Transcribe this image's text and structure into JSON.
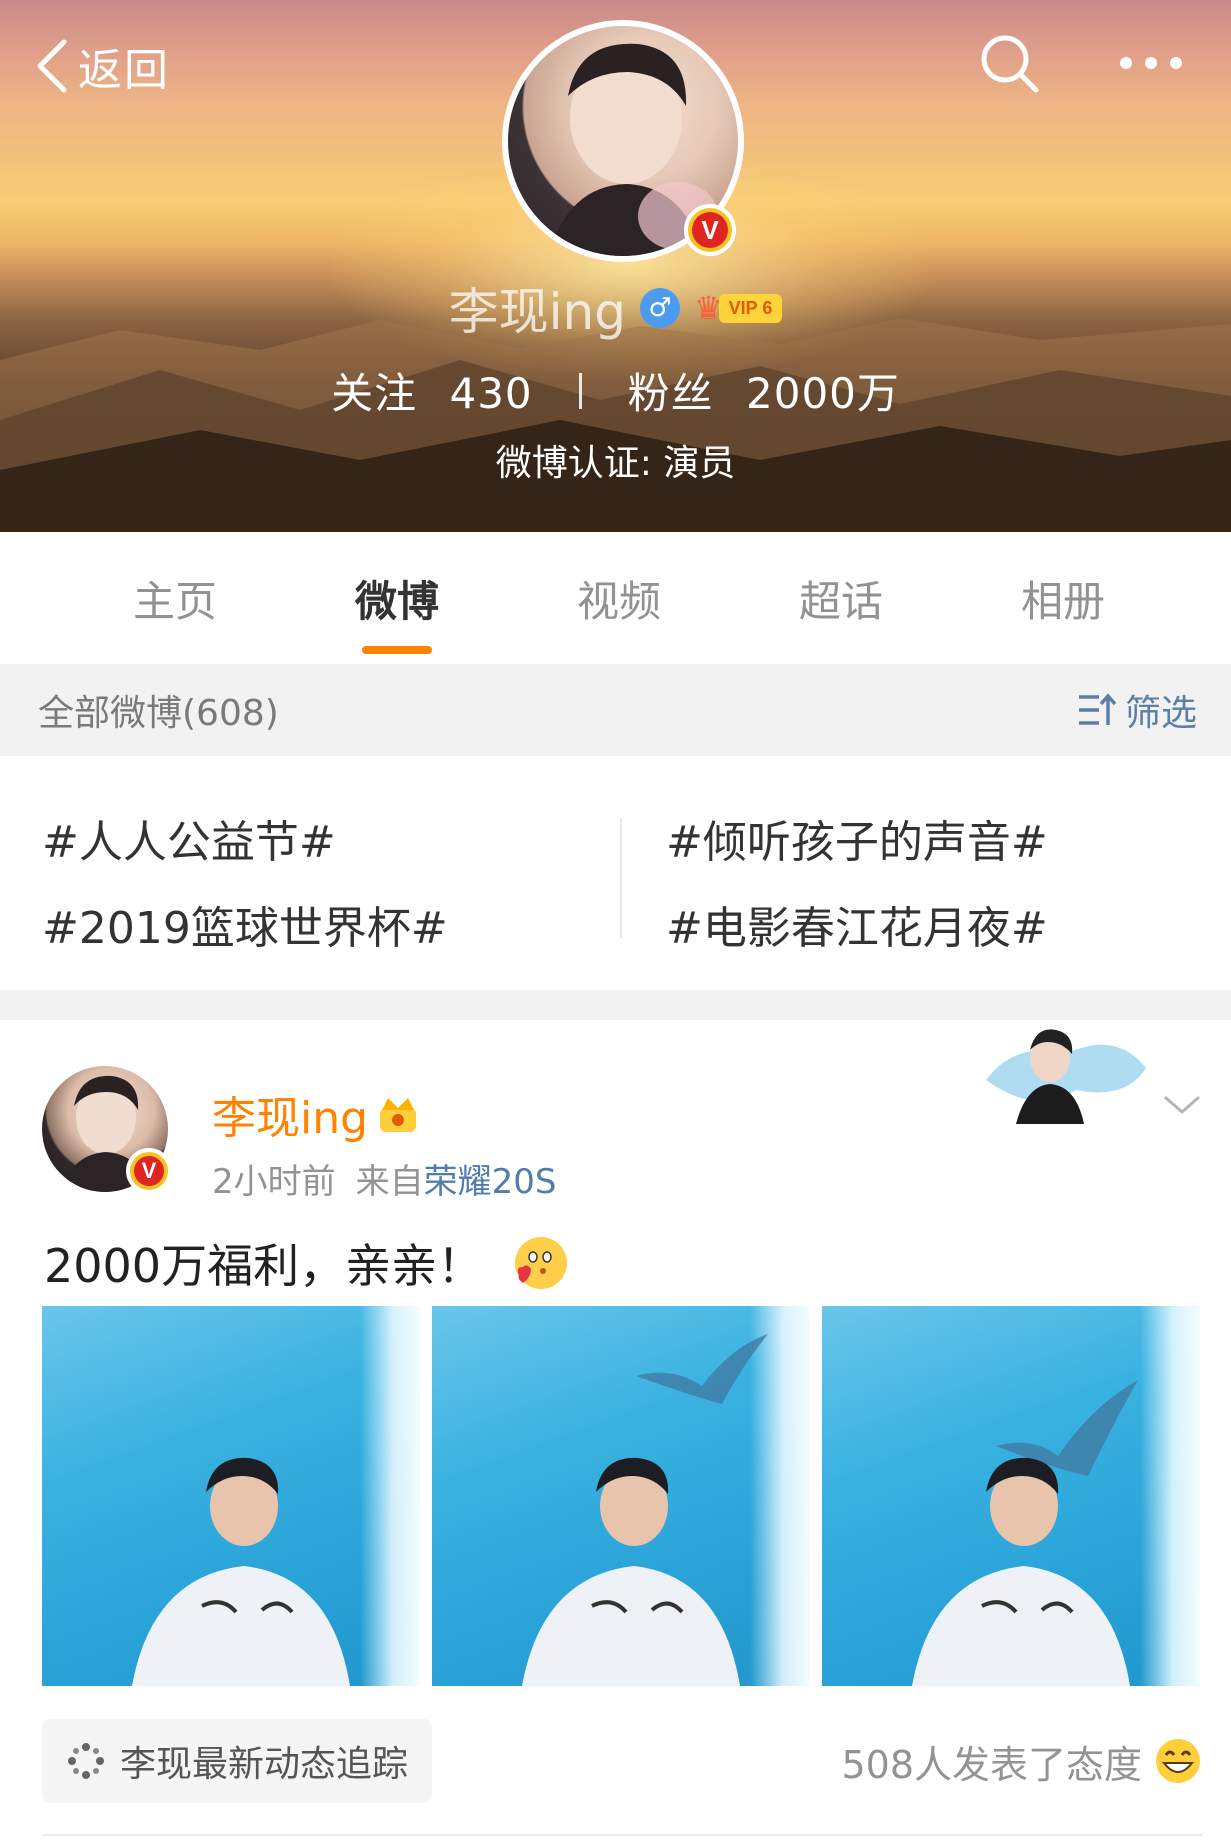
{
  "header": {
    "back_label": "返回",
    "profile_name": "李现ing",
    "gender_symbol": "♂",
    "vip_label": "VIP 6",
    "verified_mark": "V",
    "follow_label": "关注",
    "follow_count": "430",
    "fans_label": "粉丝",
    "fans_count": "2000万",
    "verification": "微博认证: 演员"
  },
  "tabs": [
    {
      "label": "主页",
      "active": false
    },
    {
      "label": "微博",
      "active": true
    },
    {
      "label": "视频",
      "active": false
    },
    {
      "label": "超话",
      "active": false
    },
    {
      "label": "相册",
      "active": false
    }
  ],
  "filter": {
    "title": "全部微博(608)",
    "button_label": "筛选"
  },
  "topics": {
    "items": [
      "#人人公益节#",
      "#倾听孩子的声音#",
      "#2019篮球世界杯#",
      "#电影春江花月夜#"
    ]
  },
  "post": {
    "author": "李现ing",
    "time": "2小时前",
    "source_prefix": "来自",
    "source": "荣耀20S",
    "text": "2000万福利，亲亲！",
    "track_label": "李现最新动态追踪",
    "reaction_text": "508人发表了态度"
  },
  "colors": {
    "accent": "#ff8200",
    "link": "#507daf",
    "filter_link": "#5b7fa8",
    "verified_red": "#e0241f"
  }
}
